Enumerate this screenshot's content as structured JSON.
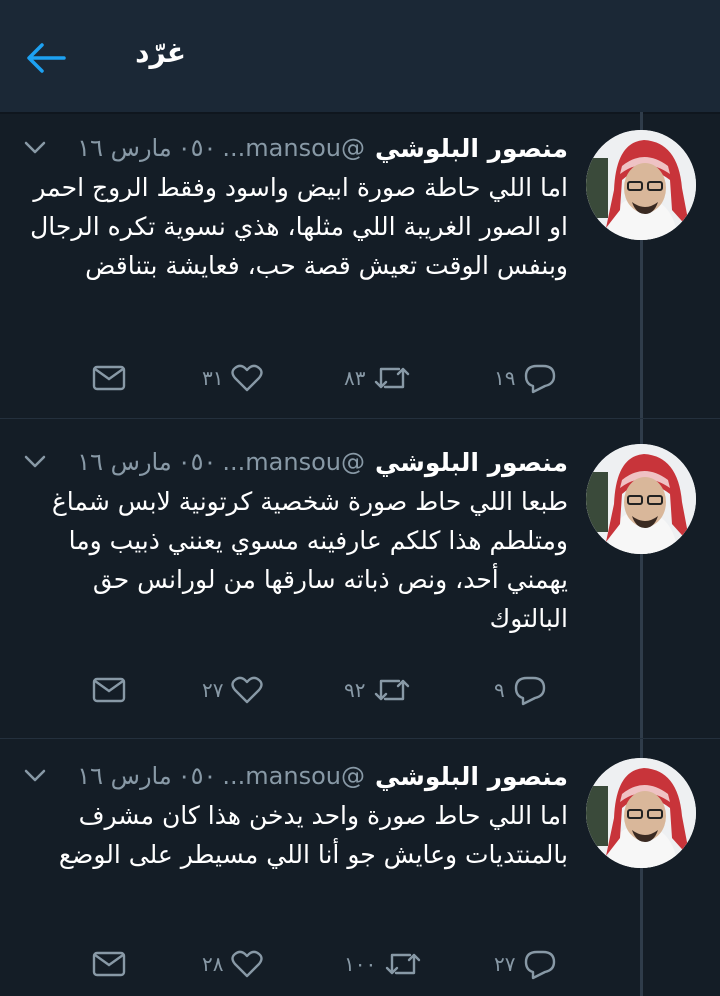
{
  "header": {
    "title": "غرّد"
  },
  "tweets": [
    {
      "author": "منصور البلوشي",
      "handle": "@mansou...",
      "time": "٠٥٠",
      "date": "مارس ١٦",
      "text": "اما اللي حاطة صورة ابيض واسود وفقط الروج احمر او الصور الغريبة اللي مثلها، هذي نسوية تكره الرجال وبنفس الوقت تعيش قصة حب، فعايشة بتناقض",
      "replies": "١٩",
      "retweets": "٨٣",
      "likes": "٣١"
    },
    {
      "author": "منصور البلوشي",
      "handle": "@mansou...",
      "time": "٠٥٠",
      "date": "مارس ١٦",
      "text": "طبعا اللي حاط صورة شخصية كرتونية لابس شماغ ومتلطم هذا كلكم عارفينه مسوي يعنني ذبيب وما يهمني أحد، ونص ذباته سارقها من لورانس حق البالتوك",
      "replies": "٩",
      "retweets": "٩٢",
      "likes": "٢٧"
    },
    {
      "author": "منصور البلوشي",
      "handle": "@mansou...",
      "time": "٠٥٠",
      "date": "مارس ١٦",
      "text": "اما اللي حاط صورة واحد يدخن هذا كان مشرف بالمنتديات وعايش جو أنا اللي مسيطر على الوضع",
      "replies": "٢٧",
      "retweets": "١٠٠",
      "likes": "٢٨"
    }
  ],
  "icons": {
    "back": "back-arrow-icon",
    "reply": "reply-icon",
    "retweet": "retweet-icon",
    "like": "heart-icon",
    "dm": "message-icon",
    "menu": "chevron-down-icon"
  },
  "colors": {
    "background": "#141d26",
    "header": "#1b2836",
    "accent": "#1da1f2",
    "muted": "#8899a6"
  }
}
